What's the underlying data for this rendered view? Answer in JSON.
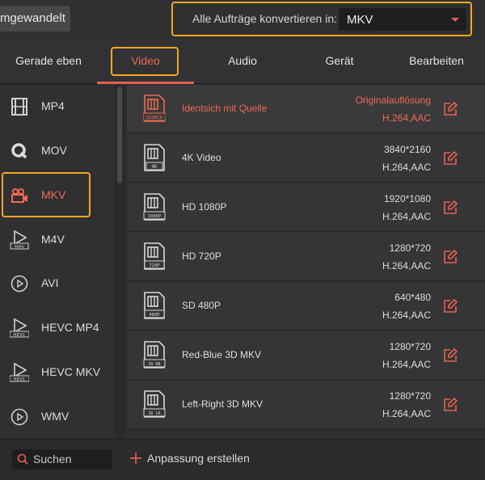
{
  "topbar": {
    "converted_tab": "mgewandelt",
    "convert_all_label": "Alle Aufträge konvertieren in:",
    "selected_format": "MKV"
  },
  "tabs": [
    {
      "label": "Gerade eben"
    },
    {
      "label": "Video",
      "active": true
    },
    {
      "label": "Audio"
    },
    {
      "label": "Gerät"
    },
    {
      "label": "Bearbeiten"
    }
  ],
  "sidebar": {
    "items": [
      {
        "label": "MP4",
        "icon": "film-icon"
      },
      {
        "label": "MOV",
        "icon": "quicktime-icon"
      },
      {
        "label": "MKV",
        "icon": "video-camera-icon",
        "active": true
      },
      {
        "label": "M4V",
        "icon": "m4v-play-icon"
      },
      {
        "label": "AVI",
        "icon": "play-circle-icon"
      },
      {
        "label": "HEVC MP4",
        "icon": "hevc-play-icon"
      },
      {
        "label": "HEVC MKV",
        "icon": "hevc-play-icon"
      },
      {
        "label": "WMV",
        "icon": "play-circle-icon"
      }
    ]
  },
  "presets": [
    {
      "name": "Identsich mit Quelle",
      "res": "Originalauflösung",
      "codec": "H.264,AAC",
      "tag": "SOURCE",
      "active": true
    },
    {
      "name": "4K Video",
      "res": "3840*2160",
      "codec": "H.264,AAC",
      "tag": "4K"
    },
    {
      "name": "HD 1080P",
      "res": "1920*1080",
      "codec": "H.264,AAC",
      "tag": "1080P"
    },
    {
      "name": "HD 720P",
      "res": "1280*720",
      "codec": "H.264,AAC",
      "tag": "720P"
    },
    {
      "name": "SD 480P",
      "res": "640*480",
      "codec": "H.264,AAC",
      "tag": "480P"
    },
    {
      "name": "Red-Blue 3D MKV",
      "res": "1280*720",
      "codec": "H.264,AAC",
      "tag": "3D RB"
    },
    {
      "name": "Left-Right 3D MKV",
      "res": "1280*720",
      "codec": "H.264,AAC",
      "tag": "3D LR"
    }
  ],
  "bottombar": {
    "search_placeholder": "Suchen",
    "create_custom": "Anpassung erstellen"
  },
  "colors": {
    "accent": "#ee6a4f",
    "highlight": "#f5a623"
  }
}
